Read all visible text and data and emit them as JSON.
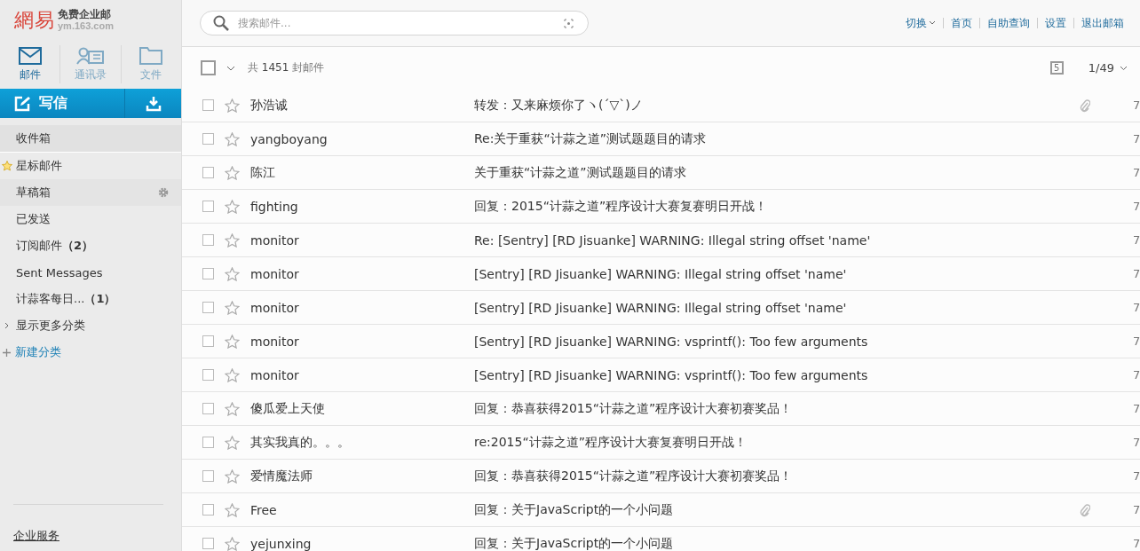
{
  "logo": {
    "mark": "網易",
    "title": "免费企业邮",
    "domain": "ym.163.com"
  },
  "nav_tabs": [
    {
      "label": "邮件",
      "kind": "mail",
      "selected": true
    },
    {
      "label": "通讯录",
      "kind": "contacts",
      "selected": false
    },
    {
      "label": "文件",
      "kind": "folder",
      "selected": false
    }
  ],
  "compose": {
    "label": "写信"
  },
  "folders": [
    {
      "label": "收件箱",
      "kind": "plain",
      "selected": true,
      "hovered": false
    },
    {
      "label": "星标邮件",
      "kind": "starred",
      "selected": false,
      "hovered": false
    },
    {
      "label": "草稿箱",
      "kind": "plain",
      "selected": false,
      "hovered": true
    },
    {
      "label": "已发送",
      "kind": "plain",
      "selected": false,
      "hovered": false
    },
    {
      "label": "订阅邮件",
      "count": "（2）",
      "kind": "plain",
      "selected": false,
      "hovered": false
    },
    {
      "label": "Sent Messages",
      "kind": "plain",
      "selected": false,
      "hovered": false
    },
    {
      "label": "计蒜客每日...",
      "count": "（1）",
      "kind": "plain",
      "selected": false,
      "hovered": false
    }
  ],
  "more_link": "显示更多分类",
  "new_category": "新建分类",
  "enterprise_service": "企业服务",
  "search": {
    "placeholder": "搜索邮件..."
  },
  "top_links": [
    {
      "label": "切换",
      "dropdown": true
    },
    {
      "label": "首页",
      "dropdown": false
    },
    {
      "label": "自助查询",
      "dropdown": false
    },
    {
      "label": "设置",
      "dropdown": false
    },
    {
      "label": "退出邮箱",
      "dropdown": false
    }
  ],
  "toolbar": {
    "select_all_checked": false,
    "count_prefix": "共",
    "count": "1451",
    "count_suffix": "封邮件",
    "calendar_day": "5",
    "page": "1/49"
  },
  "mails": [
    {
      "sender": "孙浩诚",
      "subject": "转发：又来麻烦你了ヽ(ˊ▽ˋ)ノ",
      "attachment": true,
      "date": "7",
      "checked": false,
      "starred": false
    },
    {
      "sender": "yangboyang",
      "subject": "Re:关于重获“计蒜之道”测试题题目的请求",
      "attachment": false,
      "date": "7",
      "checked": false,
      "starred": false
    },
    {
      "sender": "陈江",
      "subject": "关于重获“计蒜之道”测试题题目的请求",
      "attachment": false,
      "date": "7",
      "checked": false,
      "starred": false
    },
    {
      "sender": "fighting",
      "subject": "回复：2015“计蒜之道”程序设计大赛复赛明日开战！",
      "attachment": false,
      "date": "7",
      "checked": false,
      "starred": false
    },
    {
      "sender": "monitor",
      "subject": "Re: [Sentry] [RD Jisuanke] WARNING: Illegal string offset 'name'",
      "attachment": false,
      "date": "7",
      "checked": false,
      "starred": false
    },
    {
      "sender": "monitor",
      "subject": "[Sentry] [RD Jisuanke] WARNING: Illegal string offset 'name'",
      "attachment": false,
      "date": "7",
      "checked": false,
      "starred": false
    },
    {
      "sender": "monitor",
      "subject": "[Sentry] [RD Jisuanke] WARNING: Illegal string offset 'name'",
      "attachment": false,
      "date": "7",
      "checked": false,
      "starred": false
    },
    {
      "sender": "monitor",
      "subject": "[Sentry] [RD Jisuanke] WARNING: vsprintf(): Too few arguments",
      "attachment": false,
      "date": "7",
      "checked": false,
      "starred": false
    },
    {
      "sender": "monitor",
      "subject": "[Sentry] [RD Jisuanke] WARNING: vsprintf(): Too few arguments",
      "attachment": false,
      "date": "7",
      "checked": false,
      "starred": false
    },
    {
      "sender": "傻瓜爱上天使",
      "subject": "回复：恭喜获得2015“计蒜之道”程序设计大赛初赛奖品！",
      "attachment": false,
      "date": "7",
      "checked": false,
      "starred": false
    },
    {
      "sender": "其实我真的。。。",
      "subject": "re:2015“计蒜之道”程序设计大赛复赛明日开战！",
      "attachment": false,
      "date": "7",
      "checked": false,
      "starred": false
    },
    {
      "sender": "爱情魔法师",
      "subject": "回复：恭喜获得2015“计蒜之道”程序设计大赛初赛奖品！",
      "attachment": false,
      "date": "7",
      "checked": false,
      "starred": false
    },
    {
      "sender": "Free",
      "subject": "回复：关于JavaScript的一个小问题",
      "attachment": true,
      "date": "7",
      "checked": false,
      "starred": false
    },
    {
      "sender": "yejunxing",
      "subject": "回复：关于JavaScript的一个小问题",
      "attachment": false,
      "date": "7",
      "checked": false,
      "starred": false
    }
  ]
}
